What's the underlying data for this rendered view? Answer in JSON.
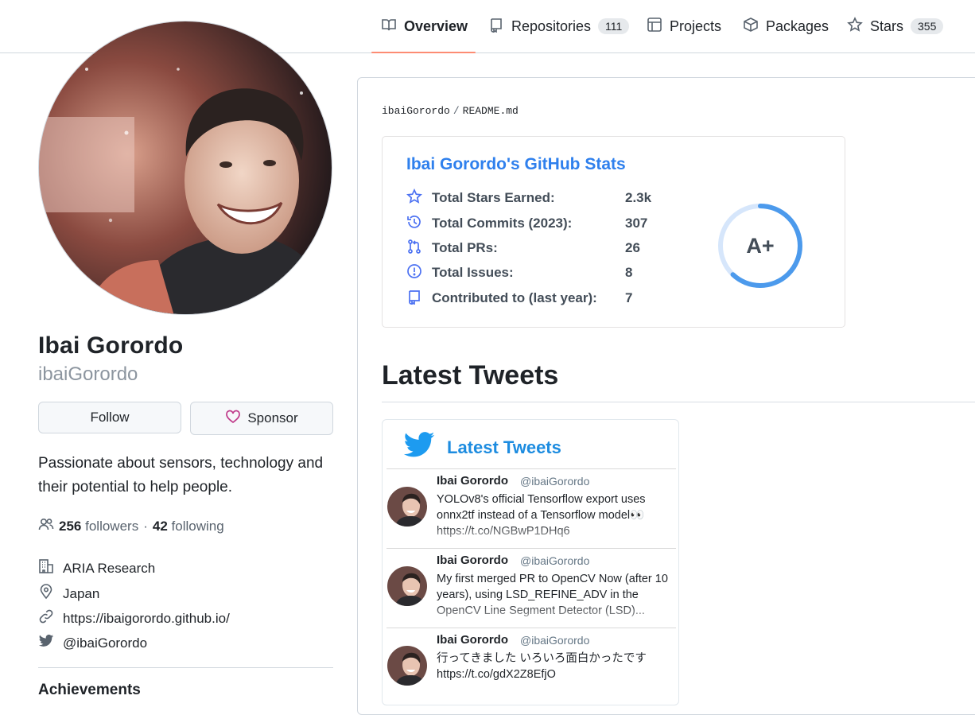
{
  "nav": {
    "tabs": [
      {
        "label": "Overview",
        "icon": "book-icon"
      },
      {
        "label": "Repositories",
        "count": "111",
        "icon": "repo-icon"
      },
      {
        "label": "Projects",
        "icon": "table-icon"
      },
      {
        "label": "Packages",
        "icon": "package-icon"
      },
      {
        "label": "Stars",
        "count": "355",
        "icon": "star-icon"
      }
    ],
    "active_tab": "Overview",
    "active_color": "#fd8c73"
  },
  "profile": {
    "name": "Ibai Gorordo",
    "username": "ibaiGorordo",
    "follow_label": "Follow",
    "sponsor_label": "Sponsor",
    "bio": "Passionate about sensors, technology and their potential to help people.",
    "followers_count": "256",
    "followers_label": "followers",
    "separator": "·",
    "following_count": "42",
    "following_label": "following",
    "organization": "ARIA Research",
    "location": "Japan",
    "website": "https://ibaigorordo.github.io/",
    "twitter": "@ibaiGorordo",
    "achievements_heading": "Achievements"
  },
  "readme": {
    "owner": "ibaiGorordo",
    "separator": "/",
    "file": "README.md",
    "stats": {
      "title": "Ibai Gorordo's GitHub Stats",
      "title_color": "#2f80ed",
      "rows": [
        {
          "label": "Total Stars Earned:",
          "value": "2.3k",
          "icon": "star-icon"
        },
        {
          "label": "Total Commits (2023):",
          "value": "307",
          "icon": "history-icon"
        },
        {
          "label": "Total PRs:",
          "value": "26",
          "icon": "pull-request-icon"
        },
        {
          "label": "Total Issues:",
          "value": "8",
          "icon": "issue-icon"
        },
        {
          "label": "Contributed to (last year):",
          "value": "7",
          "icon": "repo-icon"
        }
      ],
      "rank": "A+",
      "rank_progress": 0.62,
      "rank_color": "#4c9aec"
    },
    "tweets_heading": "Latest Tweets",
    "tweets_widget": {
      "title": "Latest Tweets",
      "title_color": "#1d8ce0",
      "tweets": [
        {
          "name": "Ibai Gorordo",
          "handle": "@ibaiGorordo",
          "text": "YOLOv8's official Tensorflow export uses onnx2tf instead of a Tensorflow model👀 https://t.co/NGBwP1DHq6"
        },
        {
          "name": "Ibai Gorordo",
          "handle": "@ibaiGorordo",
          "text": "My first merged PR to OpenCV Now (after 10 years), using LSD_REFINE_ADV in the OpenCV Line Segment Detector (LSD)..."
        },
        {
          "name": "Ibai Gorordo",
          "handle": "@ibaiGorordo",
          "text": "行ってきました いろいろ面白かったです https://t.co/gdX2Z8EfjO"
        }
      ]
    }
  }
}
